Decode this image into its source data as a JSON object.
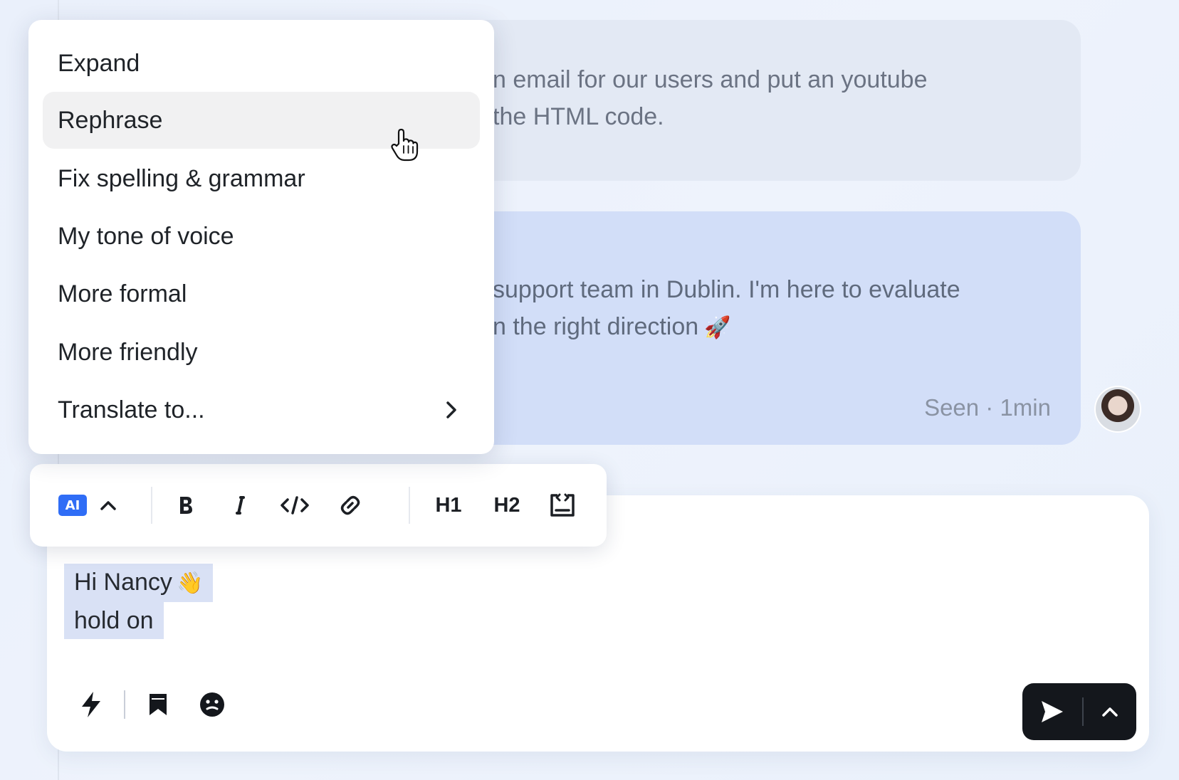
{
  "chat": {
    "message_1": "n email for our users and put an youtube\n the HTML code.",
    "message_2_line1": "support team in Dublin. I'm here to evaluate",
    "message_2_line2": "n the right direction",
    "message_2_emoji": "🚀",
    "message_2_status": "Seen · 1min"
  },
  "menu": {
    "items": [
      {
        "label": "Expand"
      },
      {
        "label": "Rephrase",
        "active": true
      },
      {
        "label": "Fix spelling & grammar"
      },
      {
        "label": "My tone of voice"
      },
      {
        "label": "More formal"
      },
      {
        "label": "More friendly"
      },
      {
        "label": "Translate to...",
        "has_submenu": true
      }
    ]
  },
  "toolbar": {
    "ai_label": "AI",
    "h1_label": "H1",
    "h2_label": "H2",
    "icons": [
      "ai-badge",
      "chevron-up",
      "bold",
      "italic",
      "code",
      "link",
      "h1",
      "h2",
      "embed"
    ]
  },
  "composer": {
    "draft_line1": "Hi Nancy",
    "draft_line1_emoji": "👋",
    "draft_line2": "hold on",
    "tools": [
      "lightning-icon",
      "bookmark-icon",
      "emoji-icon"
    ]
  },
  "colors": {
    "accent": "#2f6df6",
    "selection": "#d9e1f5",
    "send_button": "#14171c",
    "user_bubble": "#d2def8"
  }
}
